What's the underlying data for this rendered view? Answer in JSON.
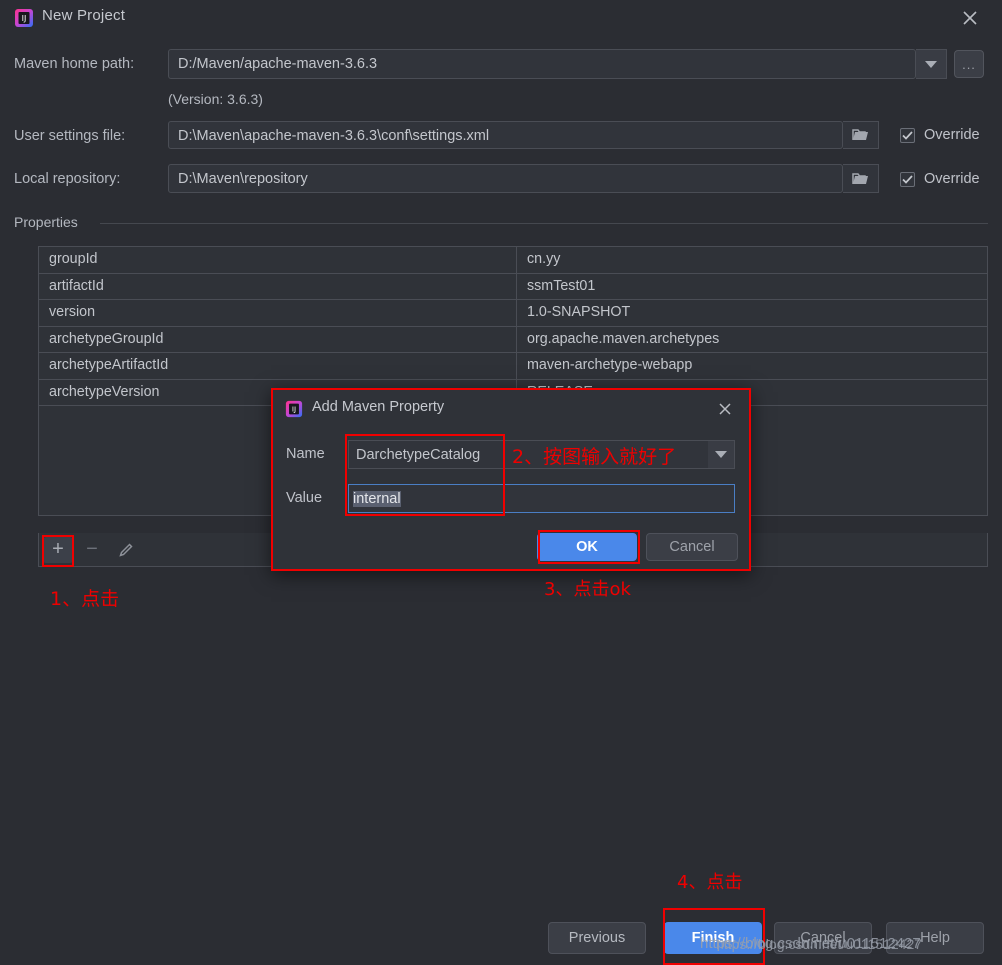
{
  "window": {
    "title": "New Project",
    "app_icon": "intellij-idea-icon",
    "close_icon": "close-icon"
  },
  "form": {
    "maven_home_label": "Maven home path:",
    "maven_home_value": "D:/Maven/apache-maven-3.6.3",
    "version_note": "(Version: 3.6.3)",
    "browse_label": "...",
    "user_settings_label": "User settings file:",
    "user_settings_value": "D:\\Maven\\apache-maven-3.6.3\\conf\\settings.xml",
    "user_settings_override": "Override",
    "local_repo_label": "Local repository:",
    "local_repo_value": "D:\\Maven\\repository",
    "local_repo_override": "Override"
  },
  "properties": {
    "group_label": "Properties",
    "rows": [
      {
        "key": "groupId",
        "value": "cn.yy"
      },
      {
        "key": "artifactId",
        "value": "ssmTest01"
      },
      {
        "key": "version",
        "value": "1.0-SNAPSHOT"
      },
      {
        "key": "archetypeGroupId",
        "value": "org.apache.maven.archetypes"
      },
      {
        "key": "archetypeArtifactId",
        "value": "maven-archetype-webapp"
      },
      {
        "key": "archetypeVersion",
        "value": "RELEASE"
      }
    ],
    "toolbar": {
      "add_label": "+",
      "remove_label": "−",
      "edit_label": "edit-pencil-icon"
    }
  },
  "dialog": {
    "title": "Add Maven Property",
    "icon": "intellij-idea-icon",
    "close_icon": "close-icon",
    "name_label": "Name",
    "name_value": "DarchetypeCatalog",
    "value_label": "Value",
    "value_value": "internal",
    "ok_label": "OK",
    "cancel_label": "Cancel",
    "dropdown_icon": "chevron-down-icon"
  },
  "annotations": [
    {
      "id": "step1",
      "text": "1、点击"
    },
    {
      "id": "step2",
      "text": "2、按图输入就好了"
    },
    {
      "id": "step3",
      "text": "3、点击ok"
    },
    {
      "id": "step4",
      "text": "4、点击"
    }
  ],
  "wizard": {
    "previous_label": "Previous",
    "finish_label": "Finish",
    "cancel_label": "Cancel",
    "help_label": "Help"
  },
  "watermark": {
    "line1": "https://blog.csdn.net/u011512427",
    "line2": "https://blog.csdn.net/u011512427"
  },
  "colors": {
    "background": "#2b2d33",
    "accent": "#4a88ea",
    "annotation": "#ee0000",
    "field_bg": "#31343b",
    "border": "#4a4d55"
  }
}
